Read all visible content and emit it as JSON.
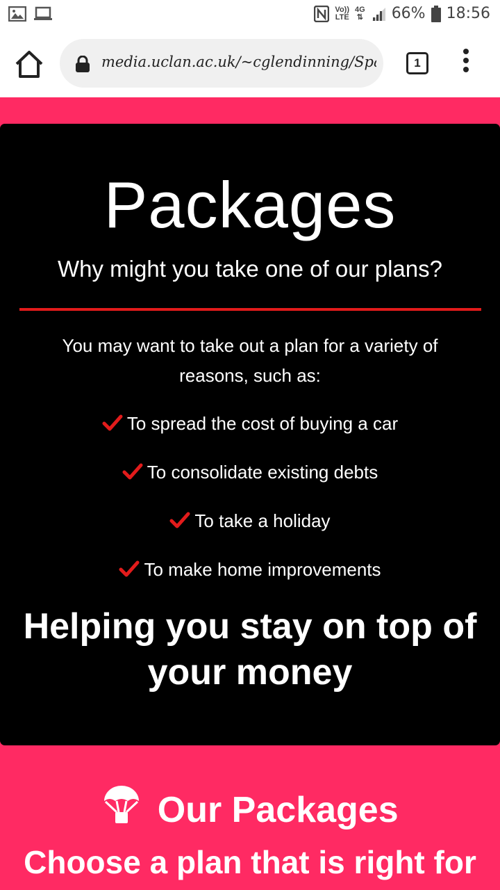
{
  "status_bar": {
    "gallery_icon": "image-icon",
    "laptop_icon": "laptop-icon",
    "nfc_icon": "nfc-icon",
    "volte_label_top": "Vo))",
    "volte_label_bottom": "LTE",
    "network_label": "4G",
    "battery_percent": "66%",
    "time": "18:56"
  },
  "browser": {
    "url": "media.uclan.ac.uk/~cglendinning/Spa",
    "tab_count": "1"
  },
  "packages_card": {
    "title": "Packages",
    "subtitle": "Why might you take one of our plans?",
    "intro": "You may want to take out a plan for a variety of reasons, such as:",
    "reasons": [
      "To spread the cost of buying a car",
      "To consolidate existing debts",
      "To take a holiday",
      "To make home improvements"
    ],
    "tagline": "Helping you stay on top of your money"
  },
  "our_packages": {
    "title": "Our Packages",
    "subtitle": "Choose a plan that is right for"
  },
  "colors": {
    "accent_pink": "#ff2a63",
    "divider_red": "#e21b1b",
    "card_background": "#000000"
  }
}
